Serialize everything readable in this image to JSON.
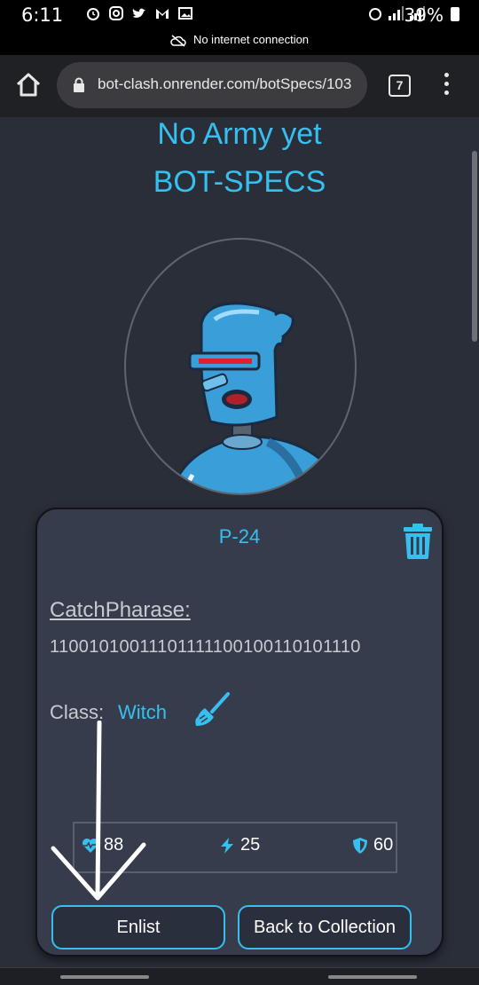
{
  "statusbar": {
    "time": "6:11",
    "battery": "39%",
    "network_notice": "No internet connection"
  },
  "browser": {
    "url": "bot-clash.onrender.com/botSpecs/103",
    "tab_count": "7"
  },
  "page": {
    "army_heading": "No Army yet",
    "specs_heading": "BOT-SPECS"
  },
  "bot": {
    "name": "P-24",
    "catchphrase_label": "CatchPharase:",
    "catchphrase": "11001010011101111100100110101110",
    "class_label": "Class:",
    "class_value": "Witch",
    "stats": {
      "health": "88",
      "damage": "25",
      "armor": "60"
    }
  },
  "buttons": {
    "enlist": "Enlist",
    "back": "Back to Collection"
  },
  "colors": {
    "accent": "#35c0ef",
    "background": "#2a2e38",
    "card": "#373c4c"
  }
}
